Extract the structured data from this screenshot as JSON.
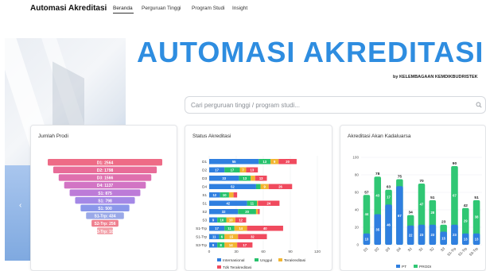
{
  "nav": {
    "brand": "Automasi Akreditasi",
    "links": [
      "Beranda",
      "Perguruan Tinggi",
      "Program Studi",
      "Insight"
    ]
  },
  "hero": {
    "title": "AUTOMASI AKREDITASI",
    "subtitle": "by KELEMBAGAAN KEMDIKBUDRISTEK"
  },
  "search": {
    "placeholder": "Cari perguruan tinggi / program studi..."
  },
  "icons": {
    "search": "search-icon",
    "carousel_prev": "chevron-left-icon"
  },
  "colors": {
    "accent": "#2e8de0",
    "internasional": "#2f7fe0",
    "unggul": "#27c26c",
    "terakreditasi": "#f2b531",
    "tdk_terakreditasi": "#f04a5e",
    "pt": "#2f7fe0",
    "prodi": "#30c774"
  },
  "cards": {
    "jumlah_prodi": "Jumlah Prodi",
    "status_akreditasi": "Status Akreditasi",
    "kadaluarsa": "Akreditasi Akan Kadaluarsa"
  },
  "chart_data": [
    {
      "type": "bar",
      "subtype": "funnel",
      "title": "Jumlah Prodi",
      "labels": [
        "D1: 2564",
        "D2: 1798",
        "D3: 1566",
        "D4: 1137",
        "S1: 875",
        "S1: 798",
        "S1: 500",
        "S1-Trp: 434",
        "S2-Trp: 256",
        "S3-Trp: 100"
      ],
      "colors": [
        "#ee6b86",
        "#e86c98",
        "#df6fae",
        "#d274c4",
        "#bd7bd8",
        "#a488e6",
        "#8a97ea",
        "#9aa9e8",
        "#ef7f8e",
        "#f2a0a8"
      ]
    },
    {
      "type": "bar",
      "orientation": "horizontal",
      "stacked": true,
      "title": "Status Akreditasi",
      "categories": [
        "D1",
        "D2",
        "D3",
        "D4",
        "S1",
        "S1",
        "S2",
        "S3",
        "S1-Trp",
        "S1-Trp",
        "S3-Trp"
      ],
      "series": [
        {
          "name": "Internasional",
          "values": [
            55,
            17,
            33,
            52,
            12,
            42,
            32,
            9,
            17,
            11,
            9
          ]
        },
        {
          "name": "Unggul",
          "values": [
            13,
            17,
            13,
            5,
            10,
            11,
            20,
            10,
            11,
            6,
            8
          ]
        },
        {
          "name": "Terakreditasi",
          "values": [
            9,
            7,
            5,
            9,
            5,
            1,
            2,
            10,
            14,
            15,
            14
          ]
        },
        {
          "name": "Tdk Terakreditasi",
          "values": [
            20,
            13,
            13,
            26,
            4,
            24,
            2,
            12,
            40,
            32,
            17
          ]
        }
      ],
      "xlim": [
        0,
        120
      ],
      "xticks": [
        0,
        30,
        60,
        90,
        120
      ],
      "legend": "bottom"
    },
    {
      "type": "bar",
      "title": "Akreditasi Akan Kadaluarsa",
      "categories": [
        "D1",
        "D2",
        "D3",
        "D4",
        "S1",
        "S1",
        "S2",
        "S3",
        "S1-Trp",
        "S1-Trp",
        "S3-Trp"
      ],
      "series": [
        {
          "name": "PT",
          "values": [
            13,
            35,
            46,
            67,
            22,
            23,
            23,
            15,
            23,
            13,
            13
          ]
        },
        {
          "name": "PRODI",
          "values": [
            57,
            78,
            63,
            75,
            34,
            70,
            51,
            23,
            90,
            42,
            51
          ]
        }
      ],
      "ylim": [
        0,
        100
      ],
      "yticks": [
        0,
        20,
        40,
        60,
        80,
        100
      ],
      "legend": "bottom"
    }
  ]
}
